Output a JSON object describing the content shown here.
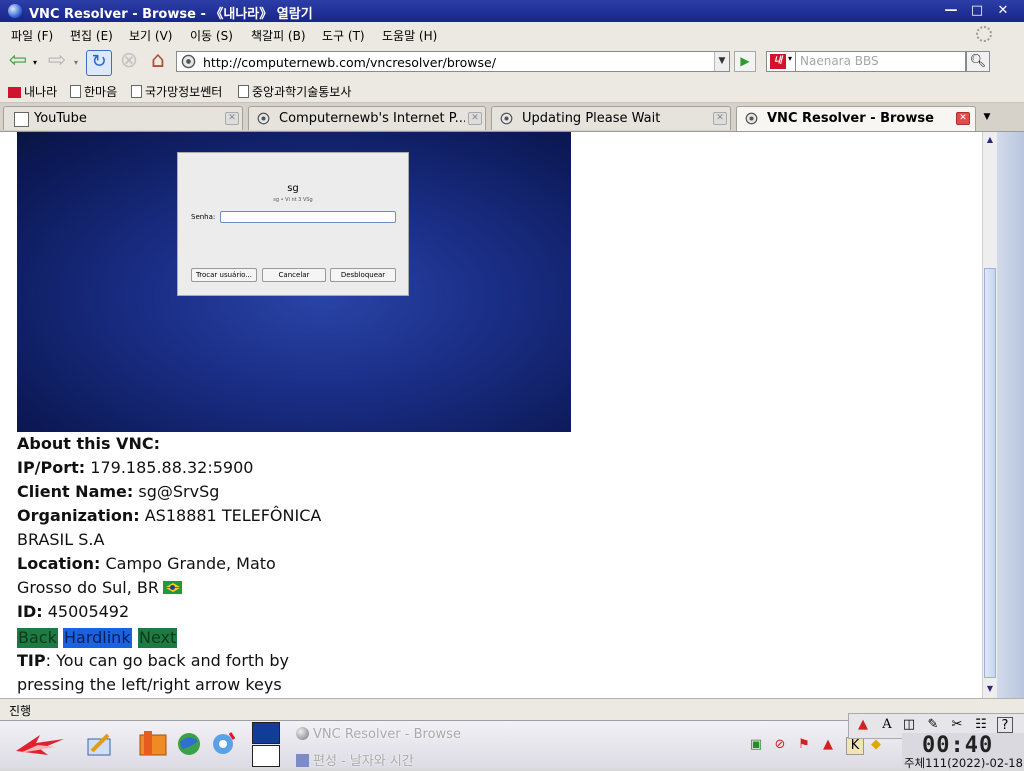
{
  "window": {
    "title": "VNC Resolver - Browse - 《내나라》 열람기",
    "minimize": "—",
    "maximize": "□",
    "close": "✕"
  },
  "menu": [
    "파일 (F)",
    "편집 (E)",
    "보기 (V)",
    "이동 (S)",
    "책갈피 (B)",
    "도구 (T)",
    "도움말 (H)"
  ],
  "nav": {
    "url": "http://computernewb.com/vncresolver/browse/",
    "search_placeholder": "Naenara BBS",
    "brand_logo": "내",
    "icons": [
      "back-arrow-icon",
      "forward-arrow-icon",
      "reload-icon",
      "stop-icon",
      "home-icon",
      "go-arrow-icon",
      "magnifier-icon"
    ]
  },
  "bookmarks": [
    "내나라",
    "한마음",
    "국가망정보쎈터",
    "중앙과학기술통보사"
  ],
  "tabs": [
    {
      "label": "YouTube",
      "active": false
    },
    {
      "label": "Computernewb's Internet P...",
      "active": false
    },
    {
      "label": "Updating Please Wait",
      "active": false
    },
    {
      "label": "VNC Resolver - Browse",
      "active": true
    }
  ],
  "screenshot_dialog": {
    "title": "sg",
    "subtitle": "sg • Vi nt 3 VSg",
    "label": "Senha:",
    "buttons": [
      "Trocar usuário...",
      "Cancelar",
      "Desbloquear"
    ]
  },
  "info": {
    "heading": "About this VNC:",
    "ip_label": "IP/Port:",
    "ip_value": " 179.185.88.32:5900",
    "client_label": "Client Name:",
    "client_value": " sg@SrvSg",
    "org_label": "Organization:",
    "org_value_1": " AS18881 TELEFÔNICA",
    "org_value_2": "BRASIL S.A",
    "location_label": "Location:",
    "location_value_1": " Campo Grande, Mato",
    "location_value_2": "Grosso do Sul, BR",
    "id_label": "ID:",
    "id_value": " 45005492",
    "links": [
      "Back",
      "Hardlink",
      "Next"
    ],
    "tip_label": "TIP",
    "tip_value_1": ": You can go back and forth by",
    "tip_value_2": "pressing the left/right arrow keys"
  },
  "status": "진행",
  "taskbar": {
    "windows": [
      "VNC Resolver - Browse",
      "편성 - 날자와 시간"
    ],
    "clock_time": "00:40",
    "clock_date": "주체111(2022)-02-18"
  },
  "colors": {
    "link_green": "#1d7a44",
    "link_blue": "#1a63e0",
    "title_blue": "#1f2f9a"
  }
}
